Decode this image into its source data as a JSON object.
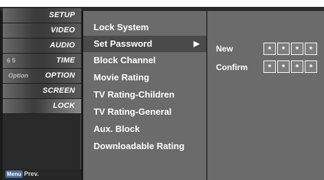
{
  "main_menu": {
    "items": [
      {
        "label": "SETUP"
      },
      {
        "label": "VIDEO"
      },
      {
        "label": "AUDIO"
      },
      {
        "label": "TIME"
      },
      {
        "label": "OPTION"
      },
      {
        "label": "SCREEN"
      },
      {
        "label": "LOCK"
      }
    ],
    "thumb_texts": {
      "time": "6 5",
      "option": "Option"
    },
    "footer": {
      "key_label": "Menu",
      "action_label": "Prev."
    }
  },
  "submenu": {
    "items": [
      {
        "label": "Lock System"
      },
      {
        "label": "Set Password"
      },
      {
        "label": "Block Channel"
      },
      {
        "label": "Movie Rating"
      },
      {
        "label": "TV Rating-Children"
      },
      {
        "label": "TV Rating-General"
      },
      {
        "label": "Aux. Block"
      },
      {
        "label": "Downloadable Rating"
      }
    ],
    "selected_arrow": "▶"
  },
  "password_panel": {
    "new_label": "New",
    "confirm_label": "Confirm",
    "new_digits": [
      "*",
      "*",
      "*",
      "*"
    ],
    "confirm_digits": [
      "*",
      "*",
      "*",
      "*"
    ]
  },
  "colors": {
    "submenu_bg": "#6b6b6b",
    "selected_bg": "#4a4a4a",
    "menu_bg": "#2a2a2a",
    "text": "#ffffff"
  }
}
